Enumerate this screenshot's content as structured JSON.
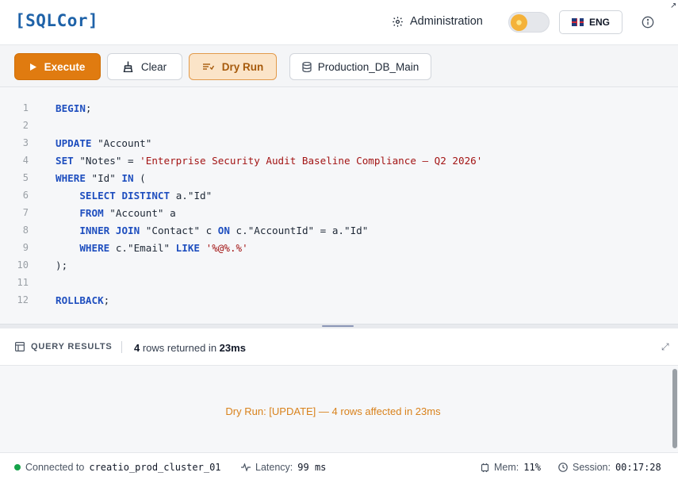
{
  "header": {
    "logo": "[SQLCor]",
    "admin_label": "Administration",
    "lang_label": "ENG"
  },
  "toolbar": {
    "execute_label": "Execute",
    "clear_label": "Clear",
    "dry_run_label": "Dry Run",
    "database_label": "Production_DB_Main"
  },
  "editor": {
    "lines": [
      {
        "n": "1"
      },
      {
        "n": "2"
      },
      {
        "n": "3"
      },
      {
        "n": "4"
      },
      {
        "n": "5"
      },
      {
        "n": "6"
      },
      {
        "n": "7"
      },
      {
        "n": "8"
      },
      {
        "n": "9"
      },
      {
        "n": "10"
      },
      {
        "n": "11"
      },
      {
        "n": "12"
      }
    ],
    "tokens": {
      "begin": "BEGIN",
      "semicolon": ";",
      "update": "UPDATE",
      "account_table": " \"Account\"",
      "set": "SET",
      "notes_eq": " \"Notes\" = ",
      "notes_value": "'Enterprise Security Audit Baseline Compliance — Q2 2026'",
      "where": "WHERE",
      "id_col": " \"Id\" ",
      "in": "IN",
      "open_paren": " (",
      "select": "SELECT",
      "distinct": "DISTINCT",
      "aid": " a.\"Id\"",
      "from": "FROM",
      "account_alias": " \"Account\" a",
      "inner": "INNER",
      "join": "JOIN",
      "contact_c": " \"Contact\" c ",
      "on": "ON",
      "join_cond": " c.\"AccountId\" = a.\"Id\"",
      "where2": "WHERE",
      "email_col": " c.\"Email\" ",
      "like": "LIKE",
      "email_pattern": "'%@%.%'",
      "close_paren": ");",
      "rollback": "ROLLBACK"
    }
  },
  "results": {
    "title": "QUERY RESULTS",
    "rows_count": "4",
    "rows_text": " rows returned in ",
    "time": "23ms",
    "message": "Dry Run: [UPDATE] — 4 rows affected in 23ms"
  },
  "status": {
    "connected_label": "Connected to",
    "cluster": "creatio_prod_cluster_01",
    "latency_label": "Latency:",
    "latency_value": "99 ms",
    "mem_label": "Mem:",
    "mem_value": "11%",
    "session_label": "Session:",
    "session_value": "00:17:28"
  },
  "colors": {
    "accent": "#e07b10",
    "logo": "#1e62a8",
    "keyword": "#1f4fbf",
    "string": "#a31515",
    "status_ok": "#16a34a"
  }
}
